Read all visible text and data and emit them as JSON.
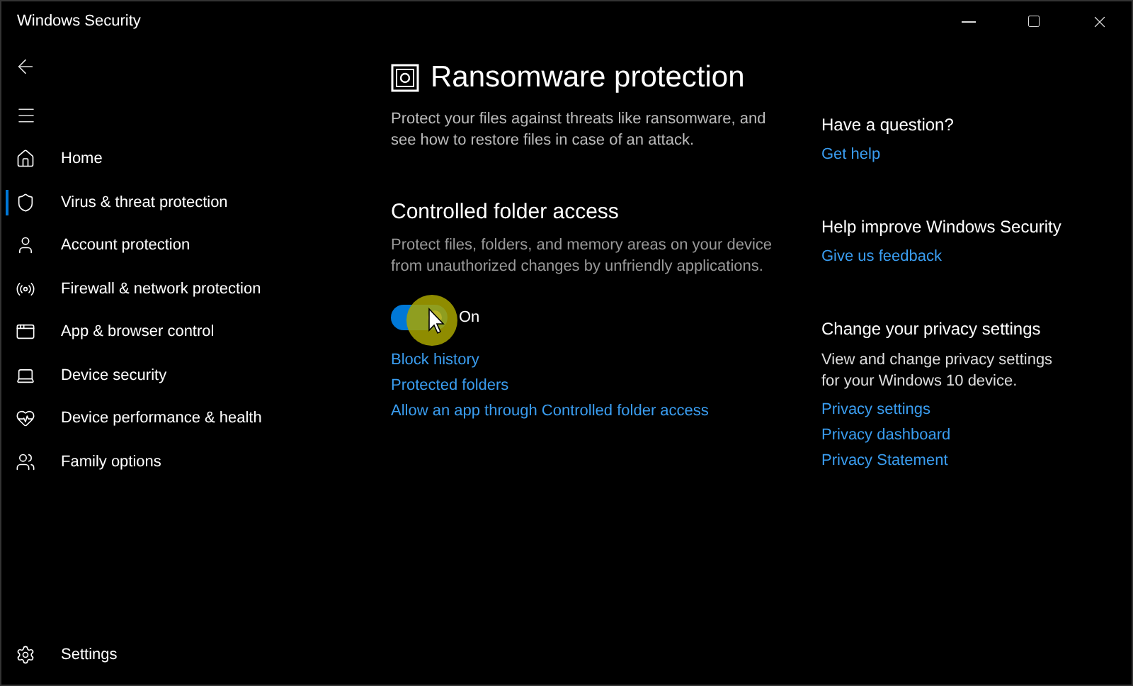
{
  "window": {
    "title": "Windows Security"
  },
  "sidebar": {
    "items": [
      {
        "label": "Home",
        "selected": false
      },
      {
        "label": "Virus & threat protection",
        "selected": true
      },
      {
        "label": "Account protection",
        "selected": false
      },
      {
        "label": "Firewall & network protection",
        "selected": false
      },
      {
        "label": "App & browser control",
        "selected": false
      },
      {
        "label": "Device security",
        "selected": false
      },
      {
        "label": "Device performance & health",
        "selected": false
      },
      {
        "label": "Family options",
        "selected": false
      }
    ],
    "settings": "Settings"
  },
  "main": {
    "title": "Ransomware protection",
    "description": "Protect your files against threats like ransomware, and see how to restore files in case of an attack.",
    "section": {
      "title": "Controlled folder access",
      "description": "Protect files, folders, and memory areas on your device from unauthorized changes by unfriendly applications.",
      "toggle": {
        "on": true,
        "label": "On"
      },
      "links": [
        "Block history",
        "Protected folders",
        "Allow an app through Controlled folder access"
      ]
    }
  },
  "aside": [
    {
      "title": "Have a question?",
      "links": [
        "Get help"
      ]
    },
    {
      "title": "Help improve Windows Security",
      "links": [
        "Give us feedback"
      ]
    },
    {
      "title": "Change your privacy settings",
      "description": "View and change privacy settings for your Windows 10 device.",
      "links": [
        "Privacy settings",
        "Privacy dashboard",
        "Privacy Statement"
      ]
    }
  ]
}
